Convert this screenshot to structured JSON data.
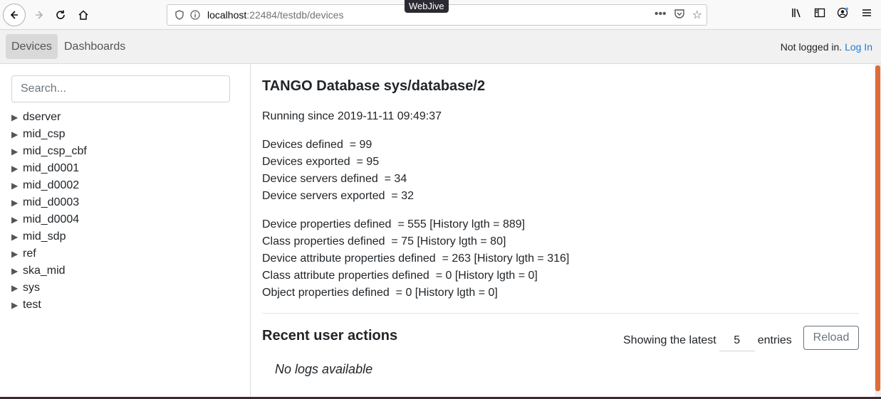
{
  "browser": {
    "tab_title": "WebJive",
    "url_host": "localhost",
    "url_rest": ":22484/testdb/devices",
    "icons": [
      "back-icon",
      "forward-icon",
      "reload-icon",
      "home-icon",
      "info-icon",
      "more-icon",
      "pocket-icon",
      "bookmark-star-icon",
      "library-icon",
      "sidebar-icon",
      "account-icon",
      "menu-icon"
    ]
  },
  "navbar": {
    "tabs": [
      {
        "label": "Devices",
        "active": true
      },
      {
        "label": "Dashboards",
        "active": false
      }
    ],
    "login_status": "Not logged in.",
    "login_link": "Log In"
  },
  "sidebar": {
    "search_placeholder": "Search...",
    "items": [
      "dserver",
      "mid_csp",
      "mid_csp_cbf",
      "mid_d0001",
      "mid_d0002",
      "mid_d0003",
      "mid_d0004",
      "mid_sdp",
      "ref",
      "ska_mid",
      "sys",
      "test"
    ]
  },
  "main": {
    "title": "TANGO Database sys/database/2",
    "running_since": "Running since 2019-11-11 09:49:37",
    "stats": [
      "Devices defined  = 99",
      "Devices exported  = 95",
      "Device servers defined  = 34",
      "Device servers exported  = 32"
    ],
    "properties": [
      "Device properties defined  = 555 [History lgth = 889]",
      "Class properties defined  = 75 [History lgth = 80]",
      "Device attribute properties defined  = 263 [History lgth = 316]",
      "Class attribute properties defined  = 0 [History lgth = 0]",
      "Object properties defined  = 0 [History lgth = 0]"
    ],
    "recent_title": "Recent user actions",
    "showing_prefix": "Showing the latest",
    "showing_count": "5",
    "showing_suffix": "entries",
    "reload_label": "Reload",
    "no_logs": "No logs available"
  },
  "colors": {
    "link": "#1e7bd6",
    "scroll_thumb": "#e06b3a"
  }
}
